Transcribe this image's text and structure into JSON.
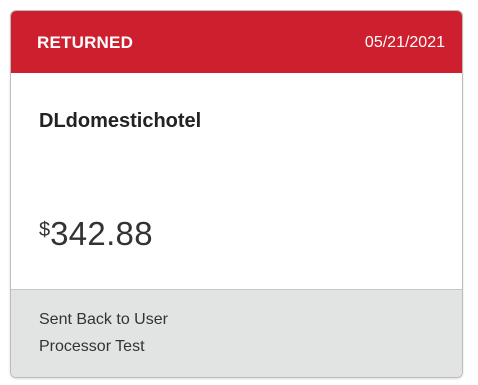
{
  "card": {
    "status": "RETURNED",
    "date": "05/21/2021",
    "merchant": "DLdomestichotel",
    "currency_symbol": "$",
    "amount": "342.88",
    "footer": {
      "line1": "Sent Back to User",
      "line2": "Processor Test"
    }
  },
  "colors": {
    "header_bg": "#cd1f2d",
    "footer_bg": "#e2e4e4"
  }
}
